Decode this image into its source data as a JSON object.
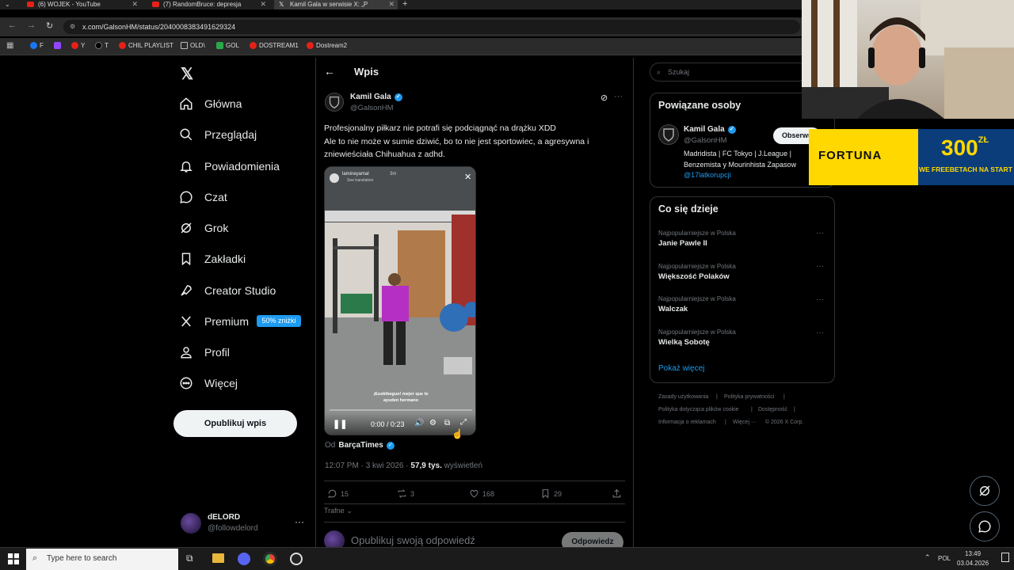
{
  "browser": {
    "tabs": [
      {
        "title": "(6) WOJEK - YouTube"
      },
      {
        "title": "(7) RandomBruce: depresja"
      },
      {
        "title": "Kamil Gala w serwisie X: „P"
      }
    ],
    "url": "x.com/GalsonHM/status/2040008383491629324",
    "bookmarks": [
      "F",
      "Y",
      "T",
      "CHIL PLAYLIST",
      "OLD\\",
      "GOL",
      "DOSTREAM1",
      "Dostream2"
    ]
  },
  "sidebar": {
    "items": [
      {
        "label": "Główna",
        "icon": "home-icon"
      },
      {
        "label": "Przeglądaj",
        "icon": "search-icon"
      },
      {
        "label": "Powiadomienia",
        "icon": "bell-icon"
      },
      {
        "label": "Czat",
        "icon": "chat-icon"
      },
      {
        "label": "Grok",
        "icon": "grok-icon"
      },
      {
        "label": "Zakładki",
        "icon": "bookmark-icon"
      },
      {
        "label": "Creator Studio",
        "icon": "rocket-icon"
      },
      {
        "label": "Premium",
        "icon": "x-icon"
      },
      {
        "label": "Profil",
        "icon": "profile-icon"
      },
      {
        "label": "Więcej",
        "icon": "more-icon"
      }
    ],
    "premium_badge": "50% zniżki",
    "post_button": "Opublikuj wpis",
    "account": {
      "name": "dELORD",
      "handle": "@followdelord"
    }
  },
  "post": {
    "header_title": "Wpis",
    "author_name": "Kamil Gala",
    "author_handle": "@GalsonHM",
    "text_line1": "Profesjonalny piłkarz nie potrafi się podciągnąć na drążku XDD",
    "text_line2": "Ale to nie może w sumie dziwić, bo to nie jest sportowiec, a agresywna i",
    "text_line3": "zniewieściała Chihuahua z adhd.",
    "video": {
      "story_user": "lamineyamal",
      "story_time": "3m",
      "story_sub": "See translation",
      "caption_line1": "¡Euskibeguo! mejor que te",
      "caption_line2": "ayuden hermano",
      "time": "0:00 / 0:23"
    },
    "from_prefix": "Od",
    "from_source": "BarçaTimes",
    "timestamp": "12:07 PM · 3 kwi 2026 ·",
    "views_count": "57,9 tys.",
    "views_label": "wyświetleń",
    "stats": {
      "replies": "15",
      "reposts": "3",
      "likes": "168",
      "bookmarks": "29"
    },
    "sort_label": "Trafne",
    "reply_placeholder": "Opublikuj swoją odpowiedź",
    "reply_button": "Odpowiedz"
  },
  "right": {
    "search_placeholder": "Szukaj",
    "related_title": "Powiązane osoby",
    "related": {
      "name": "Kamil Gala",
      "handle": "@GalsonHM",
      "follow": "Obserwuj",
      "bio_line1": "Madridista | FC Tokyo | J.League |",
      "bio_line2": "Benzemista y Mourinhista Zapasow",
      "bio_link": "@17latkorupcji"
    },
    "trends_title": "Co się dzieje",
    "trends": [
      {
        "category": "Najpopularniejsze w Polska",
        "name": "Janie Pawle II"
      },
      {
        "category": "Najpopularniejsze w Polska",
        "name": "Większość Polaków"
      },
      {
        "category": "Najpopularniejsze w Polska",
        "name": "Walczak"
      },
      {
        "category": "Najpopularniejsze w Polska",
        "name": "Wielką Sobotę"
      }
    ],
    "show_more": "Pokaż więcej",
    "footer": [
      "Zasady użytkowania",
      "Polityka prywatności",
      "Polityka dotycząca plików cookie",
      "Dostępność",
      "Informacja o reklamach",
      "Więcej ···",
      "© 2026 X Corp."
    ]
  },
  "ad": {
    "brand": "FORTUNA",
    "amount": "300",
    "currency": "ZŁ",
    "tagline": "WE FREEBETACH NA START"
  },
  "taskbar": {
    "search_placeholder": "Type here to search",
    "language": "POL",
    "time": "13:49",
    "date": "03.04.2026"
  },
  "colors": {
    "accent": "#1d9bf0",
    "background": "#000000",
    "border": "#2f3336",
    "muted": "#71767b",
    "ad_blue": "#0a3d7a",
    "ad_yellow": "#ffd800"
  }
}
